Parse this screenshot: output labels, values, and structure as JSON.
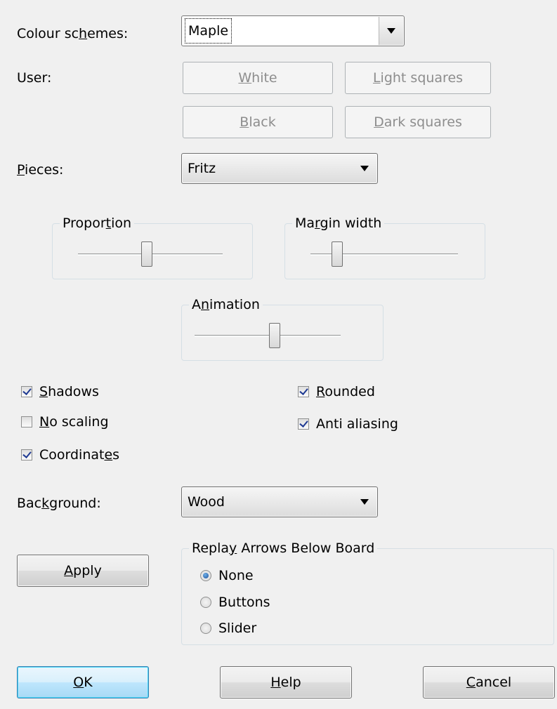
{
  "colour_schemes": {
    "label_pre": "Colour sc",
    "label_u": "h",
    "label_post": "emes:",
    "value": "Maple"
  },
  "user": {
    "label": "User:",
    "white": {
      "u": "W",
      "rest": "hite"
    },
    "light_squares": {
      "u": "L",
      "rest": "ight squares"
    },
    "black": {
      "u": "B",
      "rest": "lack"
    },
    "dark_squares": {
      "u": "D",
      "rest": "ark squares"
    }
  },
  "pieces": {
    "label_u": "P",
    "label_rest": "ieces:",
    "value": "Fritz"
  },
  "proportion": {
    "pre": "Propor",
    "u": "t",
    "post": "ion",
    "value": 0.5
  },
  "margin_width": {
    "pre": "Ma",
    "u": "r",
    "post": "gin width",
    "value": 0.2
  },
  "animation": {
    "pre": "A",
    "u": "n",
    "post": "imation",
    "value": 0.55
  },
  "checkboxes": {
    "shadows": {
      "u": "S",
      "rest": "hadows",
      "checked": true
    },
    "no_scaling": {
      "u": "N",
      "rest": "o scaling",
      "checked": false
    },
    "coordinates_pre": "Coordinat",
    "coordinates_u": "e",
    "coordinates_post": "s",
    "coordinates_checked": true,
    "rounded": {
      "u": "R",
      "rest": "ounded",
      "checked": true
    },
    "anti_aliasing": {
      "label": "Anti aliasing",
      "checked": true
    }
  },
  "background": {
    "pre": "Bac",
    "u": "k",
    "post": "ground:",
    "value": "Wood"
  },
  "apply": {
    "u": "A",
    "rest": "pply"
  },
  "replay_arrows": {
    "pre": "Repla",
    "u": "y",
    "post": " Arrows Below Board",
    "options": [
      "None",
      "Buttons",
      "Slider"
    ],
    "selected": "None"
  },
  "footer": {
    "ok": {
      "u": "O",
      "rest": "K"
    },
    "help": {
      "u": "H",
      "rest": "elp"
    },
    "cancel": {
      "u": "C",
      "rest": "ancel"
    }
  },
  "colors": {
    "background": "#f0f0f0",
    "disabled_text": "#8d8d8d",
    "default_button_border": "#3c7fb1"
  }
}
